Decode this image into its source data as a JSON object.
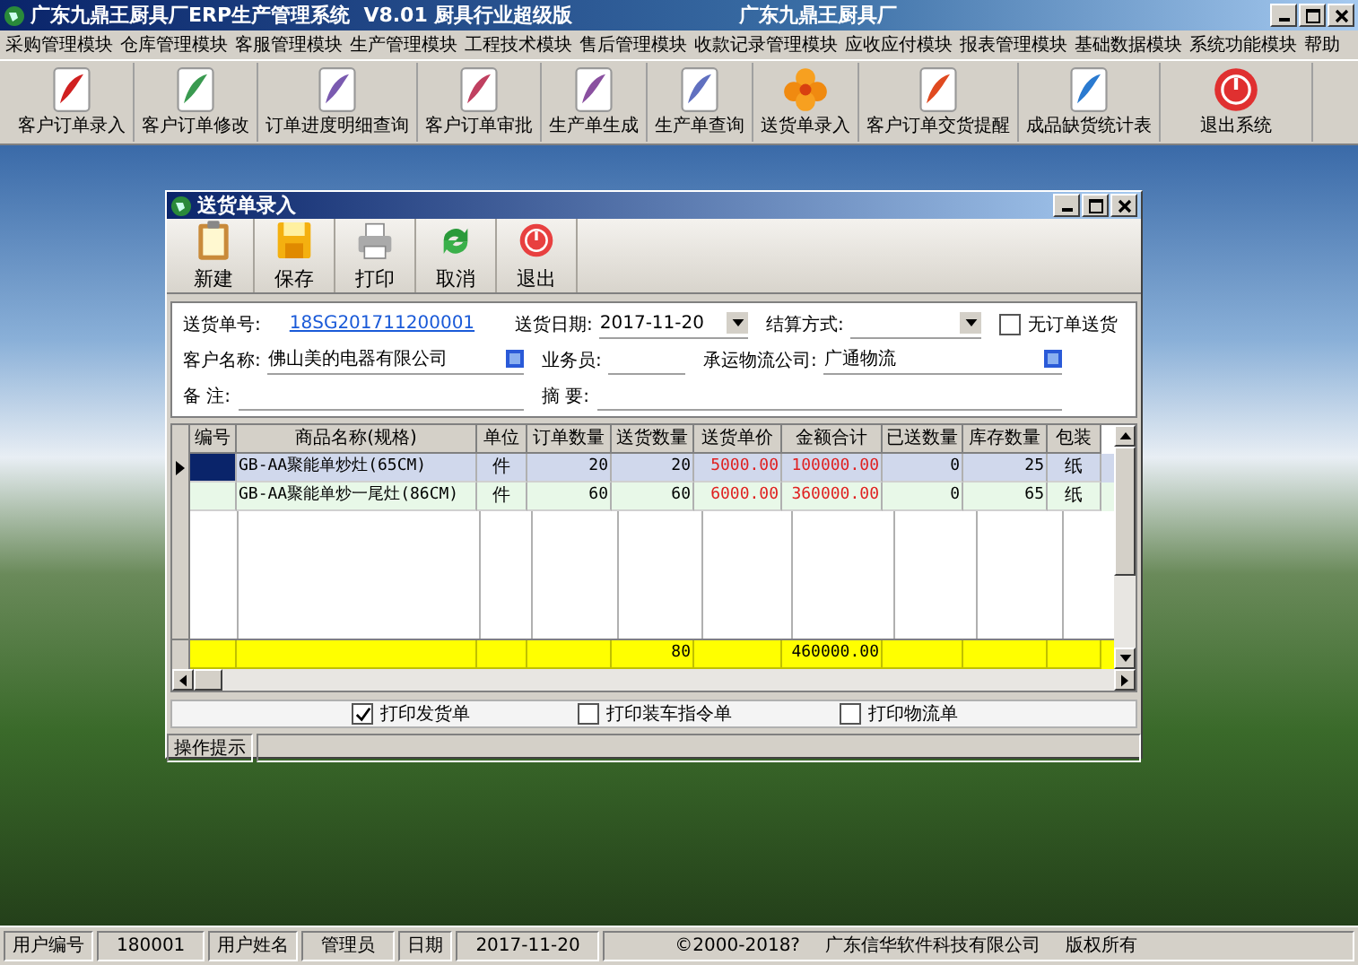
{
  "window": {
    "title": "广东九鼎王厨具厂ERP生产管理系统  V8.01 厨具行业超级版",
    "company": "广东九鼎王厨具厂"
  },
  "menu": [
    "采购管理模块",
    "仓库管理模块",
    "客服管理模块",
    "生产管理模块",
    "工程技术模块",
    "售后管理模块",
    "收款记录管理模块",
    "应收应付模块",
    "报表管理模块",
    "基础数据模块",
    "系统功能模块",
    "帮助"
  ],
  "toolbar": [
    "客户订单录入",
    "客户订单修改",
    "订单进度明细查询",
    "客户订单审批",
    "生产单生成",
    "生产单查询",
    "送货单录入",
    "客户订单交货提醒",
    "成品缺货统计表",
    "退出系统"
  ],
  "dialog": {
    "title": "送货单录入",
    "toolbar": [
      "新建",
      "保存",
      "打印",
      "取消",
      "退出"
    ],
    "form": [
      [
        {
          "label": "送货单号:",
          "kind": "link",
          "value": "18SG201711200001"
        },
        {
          "label": "送货日期:",
          "kind": "dropdown",
          "value": "2017-11-20"
        },
        {
          "label": "结算方式:",
          "kind": "dropdown"
        },
        {
          "label": "无订单送货",
          "kind": "checkbox",
          "checked": false
        }
      ],
      [
        {
          "label": "客户名称:",
          "kind": "lookup",
          "value": "佛山美的电器有限公司"
        },
        {
          "label": "业务员:",
          "kind": "text"
        },
        {
          "label": "承运物流公司:",
          "kind": "lookup",
          "value": "广通物流"
        }
      ],
      [
        {
          "label": "备 注:",
          "kind": "text"
        },
        {
          "label": "摘 要:",
          "kind": "text"
        }
      ]
    ],
    "table": {
      "columns": [
        {
          "label": "编号",
          "kind": "text"
        },
        {
          "label": "商品名称(规格)",
          "kind": "text"
        },
        {
          "label": "单位",
          "kind": "center"
        },
        {
          "label": "订单数量",
          "kind": "number"
        },
        {
          "label": "送货数量",
          "kind": "number",
          "total": "80"
        },
        {
          "label": "送货单价",
          "kind": "money"
        },
        {
          "label": "金额合计",
          "kind": "money",
          "total": "460000.00"
        },
        {
          "label": "已送数量",
          "kind": "number"
        },
        {
          "label": "库存数量",
          "kind": "number"
        },
        {
          "label": "包装",
          "kind": "center"
        }
      ],
      "rows": [
        {
          "selected": true,
          "cells": [
            "",
            "GB-AA聚能单炒灶(65CM)",
            "件",
            "20",
            "20",
            "5000.00",
            "100000.00",
            "0",
            "25",
            "纸"
          ]
        },
        {
          "selected": false,
          "cells": [
            "",
            "GB-AA聚能单炒一尾灶(86CM)",
            "件",
            "60",
            "60",
            "6000.00",
            "360000.00",
            "0",
            "65",
            "纸"
          ]
        }
      ]
    },
    "options": [
      {
        "label": "打印发货单",
        "checked": true
      },
      {
        "label": "打印装车指令单",
        "checked": false
      },
      {
        "label": "打印物流单",
        "checked": false
      }
    ],
    "hint_label": "操作提示"
  },
  "status_bar": {
    "items": [
      {
        "label": "用户编号",
        "value": "180001"
      },
      {
        "label": "用户姓名",
        "value": "管理员"
      },
      {
        "label": "日期",
        "value": "2017-11-20"
      }
    ],
    "notes": [
      "©2000-2018?",
      "广东信华软件科技有限公司",
      "版权所有"
    ]
  }
}
